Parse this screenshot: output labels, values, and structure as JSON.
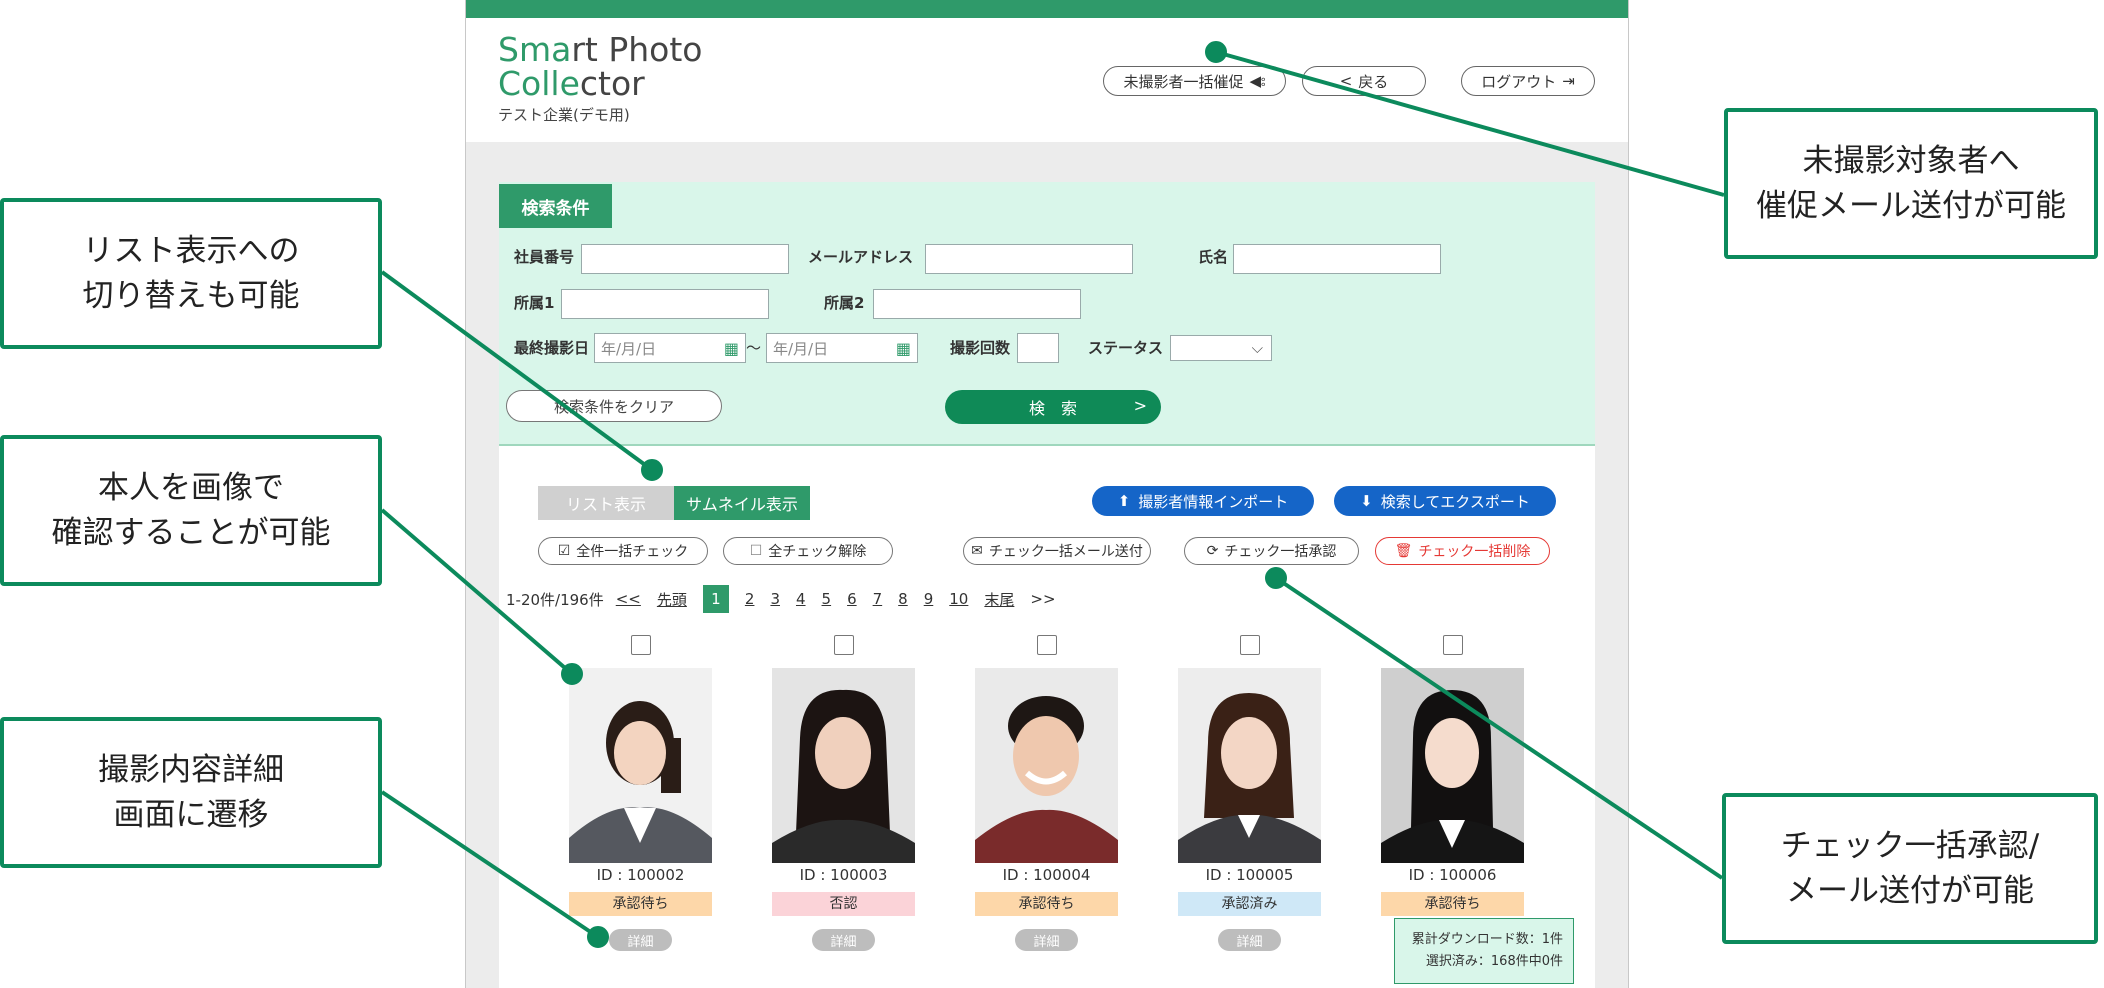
{
  "callouts": {
    "top_right": "未撮影対象者へ\n催促メール送付が可能",
    "list_switch": "リスト表示への\n切り替えも可能",
    "image_check": "本人を画像で\n確認することが可能",
    "detail": "撮影内容詳細\n画面に遷移",
    "bulk": "チェック一括承認/\nメール送付が可能"
  },
  "app": {
    "logo_line1_green": "Sma",
    "logo_line1_rest": "rt Photo",
    "logo_line2_green": "Colle",
    "logo_line2_rest": "ctor",
    "company": "テスト企業(デモ用)",
    "header_buttons": {
      "remind": "未撮影者一括催促",
      "back": "戻る",
      "logout": "ログアウト"
    }
  },
  "search": {
    "tag": "検索条件",
    "labels": {
      "employee_no": "社員番号",
      "email": "メールアドレス",
      "name": "氏名",
      "dept1": "所属1",
      "dept2": "所属2",
      "last_date": "最終撮影日",
      "shoot_count": "撮影回数",
      "status": "ステータス"
    },
    "date_placeholder": "年/月/日",
    "tilde": "～",
    "clear_button": "検索条件をクリア",
    "search_button": "検　索"
  },
  "view_tabs": {
    "list": "リスト表示",
    "thumb": "サムネイル表示"
  },
  "actions": {
    "import": "撮影者情報インポート",
    "export": "検索してエクスポート",
    "check_all": "全件一括チェック",
    "uncheck_all": "全チェック解除",
    "mail_checked": "チェック一括メール送付",
    "approve_checked": "チェック一括承認",
    "delete_checked": "チェック一括削除"
  },
  "pager": {
    "range": "1-20件/196件",
    "prev": "<<",
    "first": "先頭",
    "pages": [
      "1",
      "2",
      "3",
      "4",
      "5",
      "6",
      "7",
      "8",
      "9",
      "10"
    ],
    "current": "1",
    "last": "末尾",
    "next": ">>"
  },
  "cards": [
    {
      "id": "ID : 100002",
      "status": "承認待ち",
      "status_color": "#fdd7a9",
      "detail": "詳細"
    },
    {
      "id": "ID : 100003",
      "status": "否認",
      "status_color": "#fbd3d8",
      "detail": "詳細"
    },
    {
      "id": "ID : 100004",
      "status": "承認待ち",
      "status_color": "#fdd7a9",
      "detail": "詳細"
    },
    {
      "id": "ID : 100005",
      "status": "承認済み",
      "status_color": "#cfe8f7",
      "detail": "詳細"
    },
    {
      "id": "ID : 100006",
      "status": "承認待ち",
      "status_color": "#fdd7a9",
      "detail": "詳細"
    }
  ],
  "download_box": {
    "total": "累計ダウンロード数：1件",
    "selected": "選択済み：168件中0件"
  },
  "colors": {
    "brand_green": "#2f9a6a",
    "callout_border": "#0c8a5c",
    "blue_button": "#1565c8",
    "delete_red": "#e53935"
  }
}
